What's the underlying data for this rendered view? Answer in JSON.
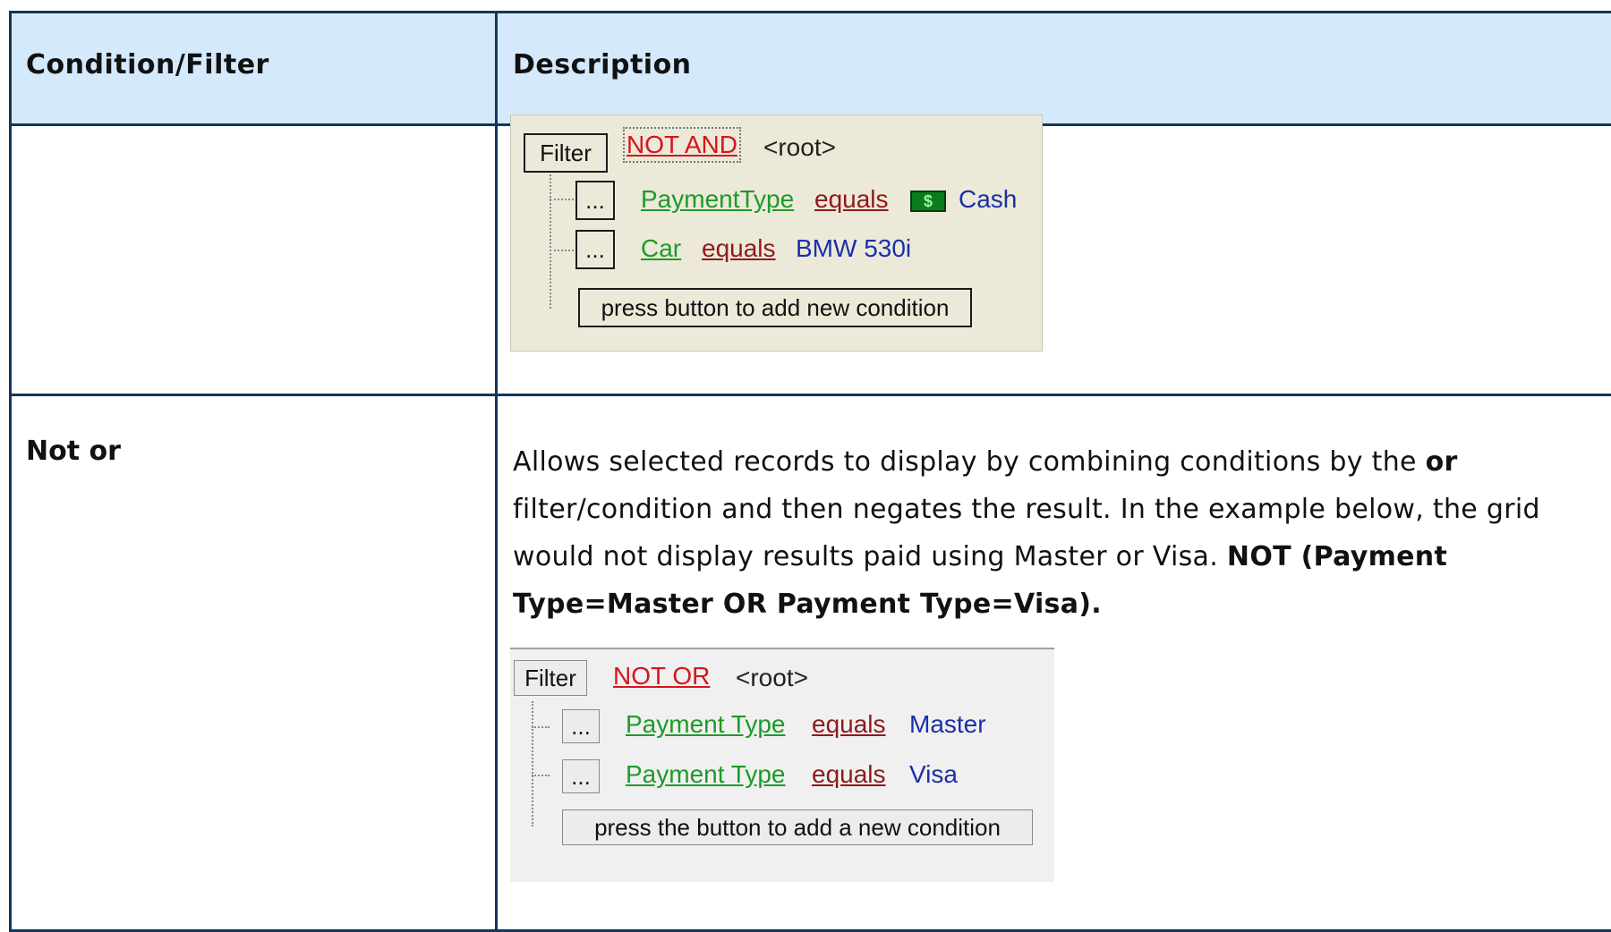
{
  "table": {
    "headers": {
      "condition": "Condition/Filter",
      "description": "Description"
    },
    "rows": [
      {
        "label": "",
        "widget": {
          "filter_label": "Filter",
          "operator": "NOT AND",
          "root": "<root>",
          "conditions": [
            {
              "button": "...",
              "field": "PaymentType",
              "op": "equals",
              "value": "Cash",
              "icon": "cash-icon"
            },
            {
              "button": "...",
              "field": "Car",
              "op": "equals",
              "value": "BMW 530i"
            }
          ],
          "add_label": "press button to add new condition"
        }
      },
      {
        "label": "Not or",
        "desc_p1": "Allows selected records to display by combining conditions by the ",
        "desc_b1": "or",
        "desc_p2": " filter/condition and then negates the result. In the example below, the grid would not display results paid using Master or Visa. ",
        "desc_b2": "NOT (Payment Type=Master OR Payment Type=Visa).",
        "widget": {
          "filter_label": "Filter",
          "operator": "NOT OR",
          "root": "<root>",
          "conditions": [
            {
              "button": "...",
              "field": "Payment Type",
              "op": "equals",
              "value": "Master"
            },
            {
              "button": "...",
              "field": "Payment Type",
              "op": "equals",
              "value": "Visa"
            }
          ],
          "add_label": "press the button to add a new condition"
        }
      }
    ]
  },
  "colors": {
    "border": "#14375a",
    "header_bg": "#d4e9fb",
    "operator": "#d8141d",
    "field": "#1e9a28",
    "op": "#8e1a1a",
    "value": "#1b2fa8"
  }
}
